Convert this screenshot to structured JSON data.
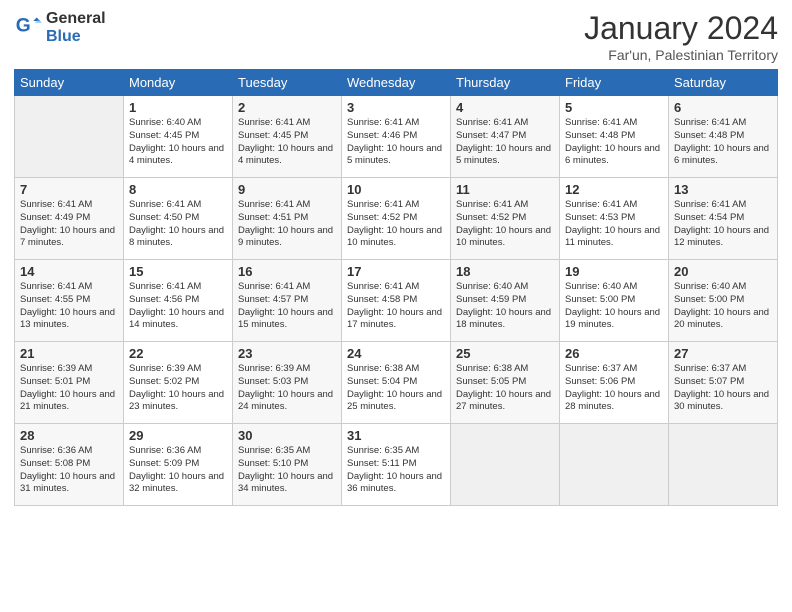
{
  "header": {
    "logo_general": "General",
    "logo_blue": "Blue",
    "title": "January 2024",
    "location": "Far'un, Palestinian Territory"
  },
  "columns": [
    "Sunday",
    "Monday",
    "Tuesday",
    "Wednesday",
    "Thursday",
    "Friday",
    "Saturday"
  ],
  "weeks": [
    [
      {
        "day": "",
        "info": ""
      },
      {
        "day": "1",
        "info": "Sunrise: 6:40 AM\nSunset: 4:45 PM\nDaylight: 10 hours\nand 4 minutes."
      },
      {
        "day": "2",
        "info": "Sunrise: 6:41 AM\nSunset: 4:45 PM\nDaylight: 10 hours\nand 4 minutes."
      },
      {
        "day": "3",
        "info": "Sunrise: 6:41 AM\nSunset: 4:46 PM\nDaylight: 10 hours\nand 5 minutes."
      },
      {
        "day": "4",
        "info": "Sunrise: 6:41 AM\nSunset: 4:47 PM\nDaylight: 10 hours\nand 5 minutes."
      },
      {
        "day": "5",
        "info": "Sunrise: 6:41 AM\nSunset: 4:48 PM\nDaylight: 10 hours\nand 6 minutes."
      },
      {
        "day": "6",
        "info": "Sunrise: 6:41 AM\nSunset: 4:48 PM\nDaylight: 10 hours\nand 6 minutes."
      }
    ],
    [
      {
        "day": "7",
        "info": "Sunrise: 6:41 AM\nSunset: 4:49 PM\nDaylight: 10 hours\nand 7 minutes."
      },
      {
        "day": "8",
        "info": "Sunrise: 6:41 AM\nSunset: 4:50 PM\nDaylight: 10 hours\nand 8 minutes."
      },
      {
        "day": "9",
        "info": "Sunrise: 6:41 AM\nSunset: 4:51 PM\nDaylight: 10 hours\nand 9 minutes."
      },
      {
        "day": "10",
        "info": "Sunrise: 6:41 AM\nSunset: 4:52 PM\nDaylight: 10 hours\nand 10 minutes."
      },
      {
        "day": "11",
        "info": "Sunrise: 6:41 AM\nSunset: 4:52 PM\nDaylight: 10 hours\nand 10 minutes."
      },
      {
        "day": "12",
        "info": "Sunrise: 6:41 AM\nSunset: 4:53 PM\nDaylight: 10 hours\nand 11 minutes."
      },
      {
        "day": "13",
        "info": "Sunrise: 6:41 AM\nSunset: 4:54 PM\nDaylight: 10 hours\nand 12 minutes."
      }
    ],
    [
      {
        "day": "14",
        "info": "Sunrise: 6:41 AM\nSunset: 4:55 PM\nDaylight: 10 hours\nand 13 minutes."
      },
      {
        "day": "15",
        "info": "Sunrise: 6:41 AM\nSunset: 4:56 PM\nDaylight: 10 hours\nand 14 minutes."
      },
      {
        "day": "16",
        "info": "Sunrise: 6:41 AM\nSunset: 4:57 PM\nDaylight: 10 hours\nand 15 minutes."
      },
      {
        "day": "17",
        "info": "Sunrise: 6:41 AM\nSunset: 4:58 PM\nDaylight: 10 hours\nand 17 minutes."
      },
      {
        "day": "18",
        "info": "Sunrise: 6:40 AM\nSunset: 4:59 PM\nDaylight: 10 hours\nand 18 minutes."
      },
      {
        "day": "19",
        "info": "Sunrise: 6:40 AM\nSunset: 5:00 PM\nDaylight: 10 hours\nand 19 minutes."
      },
      {
        "day": "20",
        "info": "Sunrise: 6:40 AM\nSunset: 5:00 PM\nDaylight: 10 hours\nand 20 minutes."
      }
    ],
    [
      {
        "day": "21",
        "info": "Sunrise: 6:39 AM\nSunset: 5:01 PM\nDaylight: 10 hours\nand 21 minutes."
      },
      {
        "day": "22",
        "info": "Sunrise: 6:39 AM\nSunset: 5:02 PM\nDaylight: 10 hours\nand 23 minutes."
      },
      {
        "day": "23",
        "info": "Sunrise: 6:39 AM\nSunset: 5:03 PM\nDaylight: 10 hours\nand 24 minutes."
      },
      {
        "day": "24",
        "info": "Sunrise: 6:38 AM\nSunset: 5:04 PM\nDaylight: 10 hours\nand 25 minutes."
      },
      {
        "day": "25",
        "info": "Sunrise: 6:38 AM\nSunset: 5:05 PM\nDaylight: 10 hours\nand 27 minutes."
      },
      {
        "day": "26",
        "info": "Sunrise: 6:37 AM\nSunset: 5:06 PM\nDaylight: 10 hours\nand 28 minutes."
      },
      {
        "day": "27",
        "info": "Sunrise: 6:37 AM\nSunset: 5:07 PM\nDaylight: 10 hours\nand 30 minutes."
      }
    ],
    [
      {
        "day": "28",
        "info": "Sunrise: 6:36 AM\nSunset: 5:08 PM\nDaylight: 10 hours\nand 31 minutes."
      },
      {
        "day": "29",
        "info": "Sunrise: 6:36 AM\nSunset: 5:09 PM\nDaylight: 10 hours\nand 32 minutes."
      },
      {
        "day": "30",
        "info": "Sunrise: 6:35 AM\nSunset: 5:10 PM\nDaylight: 10 hours\nand 34 minutes."
      },
      {
        "day": "31",
        "info": "Sunrise: 6:35 AM\nSunset: 5:11 PM\nDaylight: 10 hours\nand 36 minutes."
      },
      {
        "day": "",
        "info": ""
      },
      {
        "day": "",
        "info": ""
      },
      {
        "day": "",
        "info": ""
      }
    ]
  ]
}
